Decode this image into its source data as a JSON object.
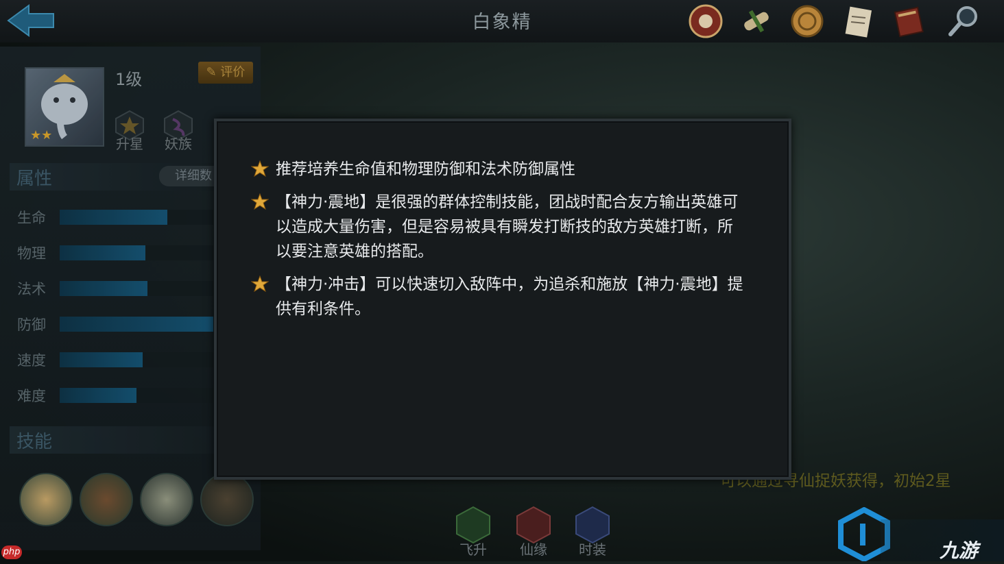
{
  "header": {
    "title": "白象精"
  },
  "top_icons": [
    "seal-icon",
    "scroll-icon",
    "coin-icon",
    "document-icon",
    "book-icon",
    "magnifier-icon"
  ],
  "hero": {
    "level": "1级",
    "rate_label": "评价",
    "stars": "★★",
    "badges": [
      {
        "label": "升星",
        "icon": "star-badge-icon"
      },
      {
        "label": "妖族",
        "icon": "race-badge-icon"
      }
    ]
  },
  "attributes": {
    "header": "属性",
    "detail_label": "详细数",
    "stats": [
      {
        "label": "生命",
        "fill": 0.7
      },
      {
        "label": "物理",
        "fill": 0.56
      },
      {
        "label": "法术",
        "fill": 0.57
      },
      {
        "label": "防御",
        "fill": 1.0
      },
      {
        "label": "速度",
        "fill": 0.54
      },
      {
        "label": "难度",
        "fill": 0.5
      }
    ]
  },
  "skills": {
    "header": "技能"
  },
  "bottom": {
    "note": "可以通过寻仙捉妖获得，初始2星",
    "buttons": [
      {
        "label": "飞升"
      },
      {
        "label": "仙缘"
      },
      {
        "label": "时装"
      }
    ]
  },
  "modal": {
    "tips": [
      {
        "text": "推荐培养生命值和物理防御和法术防御属性"
      },
      {
        "text": "【神力·震地】是很强的群体控制技能，团战时配合友方输出英雄可以造成大量伤害，但是容易被具有瞬发打断技的敌方英雄打断，所以要注意英雄的搭配。"
      },
      {
        "text": "【神力·冲击】可以快速切入敌阵中，为追杀和施放【神力·震地】提供有利条件。"
      }
    ]
  },
  "watermarks": {
    "php": "php",
    "brand": "九游"
  },
  "colors": {
    "accent_gold": "#d9a22b",
    "bar_fill": "#145273",
    "modal_bg": "#171b1d"
  }
}
